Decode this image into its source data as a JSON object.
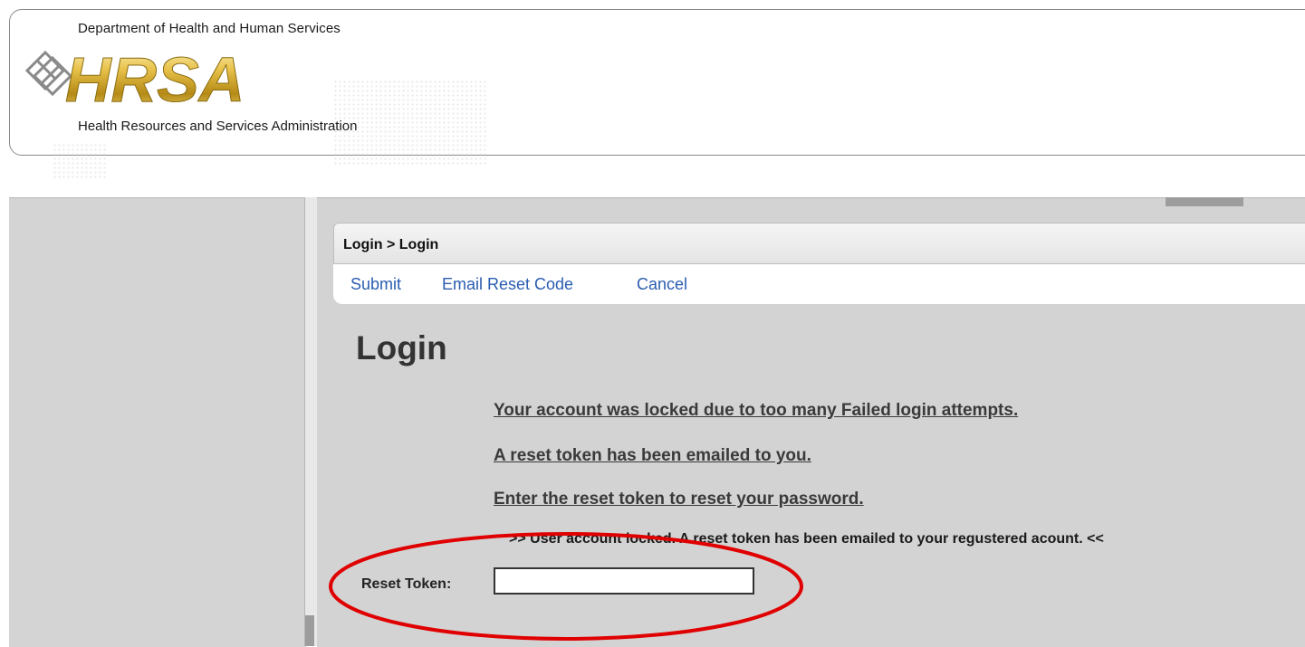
{
  "header": {
    "dept_line": "Department of Health and Human Services",
    "logo_text": "HRSA",
    "agency_line": "Health Resources and Services Administration"
  },
  "breadcrumb": "Login > Login",
  "toolbar": {
    "submit_label": "Submit",
    "email_reset_label": "Email Reset Code",
    "cancel_label": "Cancel"
  },
  "page_title": "Login",
  "messages": {
    "locked": "Your account was locked due to too many Failed login attempts.",
    "emailed": "A reset token has been emailed to you.",
    "enter": "Enter the reset token to reset your password."
  },
  "status_text": ">> User account locked. A reset token has been emailed to your regustered acount. <<",
  "reset_token": {
    "label": "Reset Token:",
    "value": ""
  },
  "colors": {
    "link": "#2a5db0",
    "logo_gold": "#c9a227",
    "annotation": "#e00000",
    "panel_bg": "#d3d3d3"
  }
}
